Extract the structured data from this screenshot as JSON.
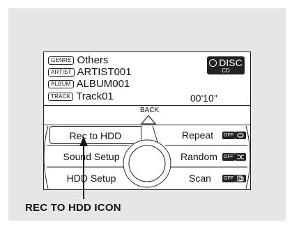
{
  "track_info": {
    "genre_tag": "GENRE",
    "genre_value": "Others",
    "artist_tag": "ARTIST",
    "artist_value": "ARTIST001",
    "album_tag": "ALBUM",
    "album_value": "ALBUM001",
    "track_tag": "TRACK",
    "track_value": "Track01",
    "elapsed_time": "00'10\""
  },
  "source": {
    "label": "DISC",
    "sub_label": "CD"
  },
  "nav": {
    "back_label": "BACK"
  },
  "menu": {
    "rec_to_hdd": "Rec to HDD",
    "sound_setup": "Sound Setup",
    "hdd_setup": "HDD Setup",
    "repeat": "Repeat",
    "random": "Random",
    "scan": "Scan",
    "off_badge": "OFF"
  },
  "icons": {
    "repeat": "repeat-icon",
    "random": "shuffle-icon",
    "scan": "scan-icon",
    "disc": "disc-icon",
    "back": "up-arrow-icon",
    "dial": "selector-dial-icon"
  },
  "callout": {
    "text": "REC TO HDD ICON"
  },
  "colors": {
    "panel_bg": "#e6e6e6",
    "screen_bg": "#ffffff",
    "ink": "#222222"
  }
}
